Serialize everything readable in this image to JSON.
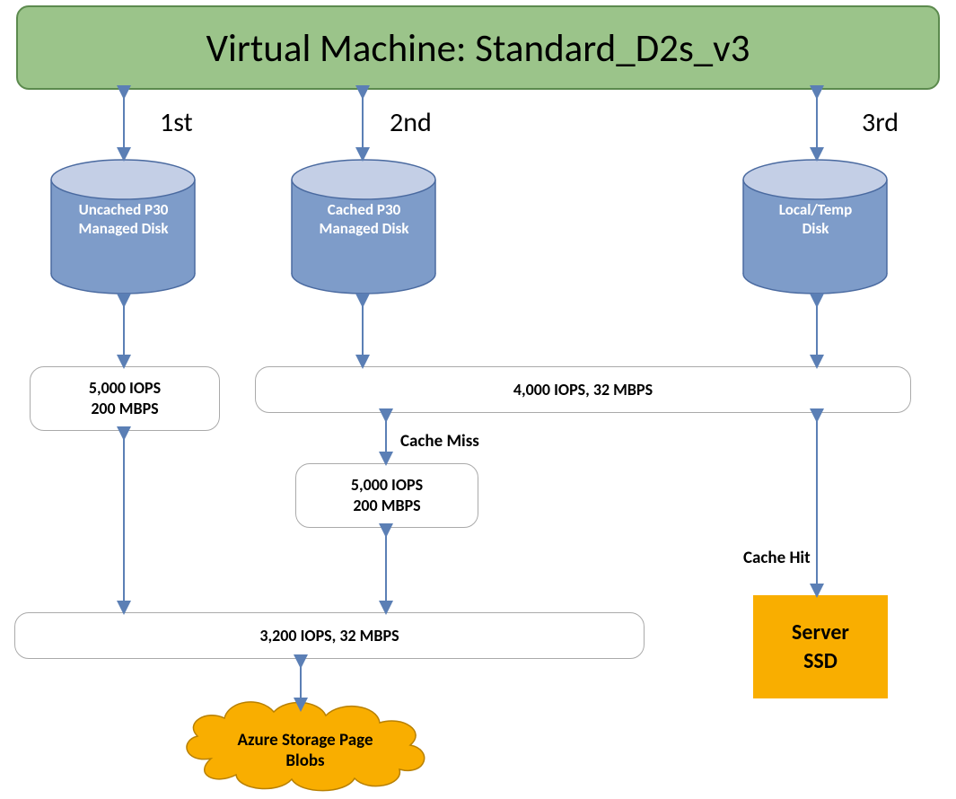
{
  "vm_title": "Virtual Machine: Standard_D2s_v3",
  "ordinals": {
    "first": "1st",
    "second": "2nd",
    "third": "3rd"
  },
  "disks": {
    "uncached": "Uncached P30\nManaged Disk",
    "cached": "Cached P30\nManaged Disk",
    "local": "Local/Temp\nDisk"
  },
  "boxes": {
    "uncached_limit": "5,000 IOPS\n200 MBPS",
    "cached_limit": "4,000 IOPS, 32 MBPS",
    "cache_miss_limit": "5,000 IOPS\n200 MBPS",
    "storage_limit": "3,200 IOPS, 32 MBPS"
  },
  "labels": {
    "cache_miss": "Cache Miss",
    "cache_hit": "Cache Hit"
  },
  "ssd": "Server\nSSD",
  "cloud": "Azure Storage Page\nBlobs",
  "colors": {
    "vm_fill": "#9bc48a",
    "disk_fill": "#7e9cc9",
    "disk_top": "#c4cfe6",
    "arrow": "#5b7fb5",
    "orange": "#f9ae00"
  }
}
